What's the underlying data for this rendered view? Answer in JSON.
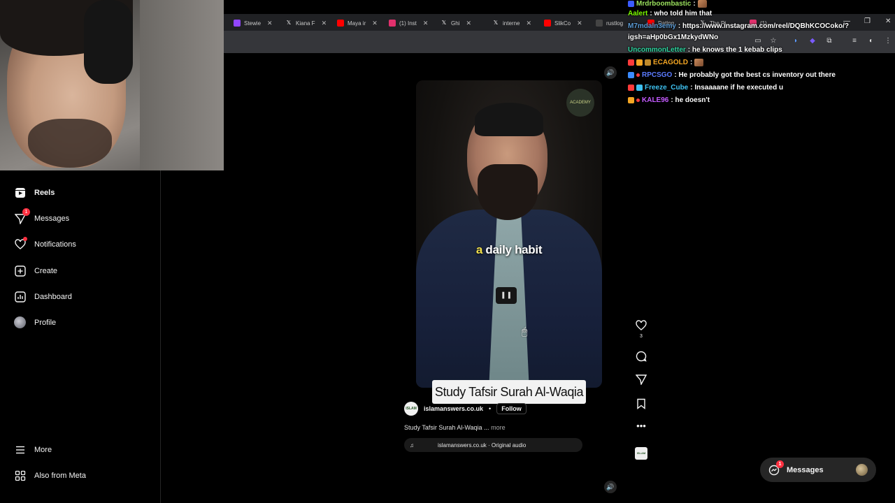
{
  "browser": {
    "tabs": [
      {
        "label": "Stewie",
        "fav": "twitch",
        "color": "#9146ff"
      },
      {
        "label": "Kiana F",
        "fav": "x",
        "color": "#000000"
      },
      {
        "label": "Maya ir",
        "fav": "youtube",
        "color": "#ff0000"
      },
      {
        "label": "(1) Inst",
        "fav": "instagram",
        "color": "#e1306c"
      },
      {
        "label": "Ghi",
        "fav": "x",
        "color": "#000000"
      },
      {
        "label": "interne",
        "fav": "x",
        "color": "#000000"
      },
      {
        "label": "SlikCo",
        "fav": "youtube",
        "color": "#ff0000"
      },
      {
        "label": "rustlog",
        "fav": "page",
        "color": "#444444"
      },
      {
        "label": "Dating",
        "fav": "youtube",
        "color": "#ff0000"
      },
      {
        "label": "The Ri",
        "fav": "x",
        "color": "#000000"
      },
      {
        "label": "(1)",
        "fav": "instagram",
        "color": "#e1306c"
      }
    ]
  },
  "sidebar": {
    "reels": "Reels",
    "messages": "Messages",
    "messages_badge": "1",
    "notifications": "Notifications",
    "create": "Create",
    "dashboard": "Dashboard",
    "profile": "Profile",
    "more": "More",
    "also_from_meta": "Also from Meta"
  },
  "reel": {
    "logo_text": "ACADEMY",
    "caption_highlight": "a",
    "caption_rest": "daily habit",
    "title_card": "Study Tafsir Surah Al-Waqia",
    "author_avatar": "ISLAM",
    "author": "islamanswers.co.uk",
    "separator": "•",
    "follow": "Follow",
    "caption": "Study Tafsir Surah Al-Waqia ...",
    "more": "more",
    "audio": "islamanswers.co.uk · Original audio",
    "like_count": "3",
    "audio_thumb": "ISLAM"
  },
  "chat": [
    {
      "user": "Mrdrboombastic",
      "user_color": "#9be15d",
      "text": " :"
    },
    {
      "user": "Aalert",
      "user_color": "#7cfc00",
      "text": ": who told him that"
    },
    {
      "user": "M7mdaln3emy",
      "user_color": "#5b9bd5",
      "text": ": https://www.instagram.com/reel/DQBhKCOCoko/?"
    },
    {
      "user": "",
      "user_color": "#ffffff",
      "text": "igsh=aHp0bGx1MzkydWNo"
    },
    {
      "user": "UncommonLetter",
      "user_color": "#2fd4a0",
      "text": ": he knows the 1 kebab clips"
    },
    {
      "user": "ECAGOLD",
      "user_color": "#f5a623",
      "text": ":"
    },
    {
      "user": "RPCSGO",
      "user_color": "#5b7bff",
      "text": ": He probably got the best cs inventory out there"
    },
    {
      "user": "Freeze_Cube",
      "user_color": "#3ec1f0",
      "text": ": Insaaaane if he executed u"
    },
    {
      "user": "KALE96",
      "user_color": "#c45bff",
      "text": ": he doesn't"
    }
  ],
  "messages_pill": {
    "label": "Messages",
    "badge": "1"
  }
}
